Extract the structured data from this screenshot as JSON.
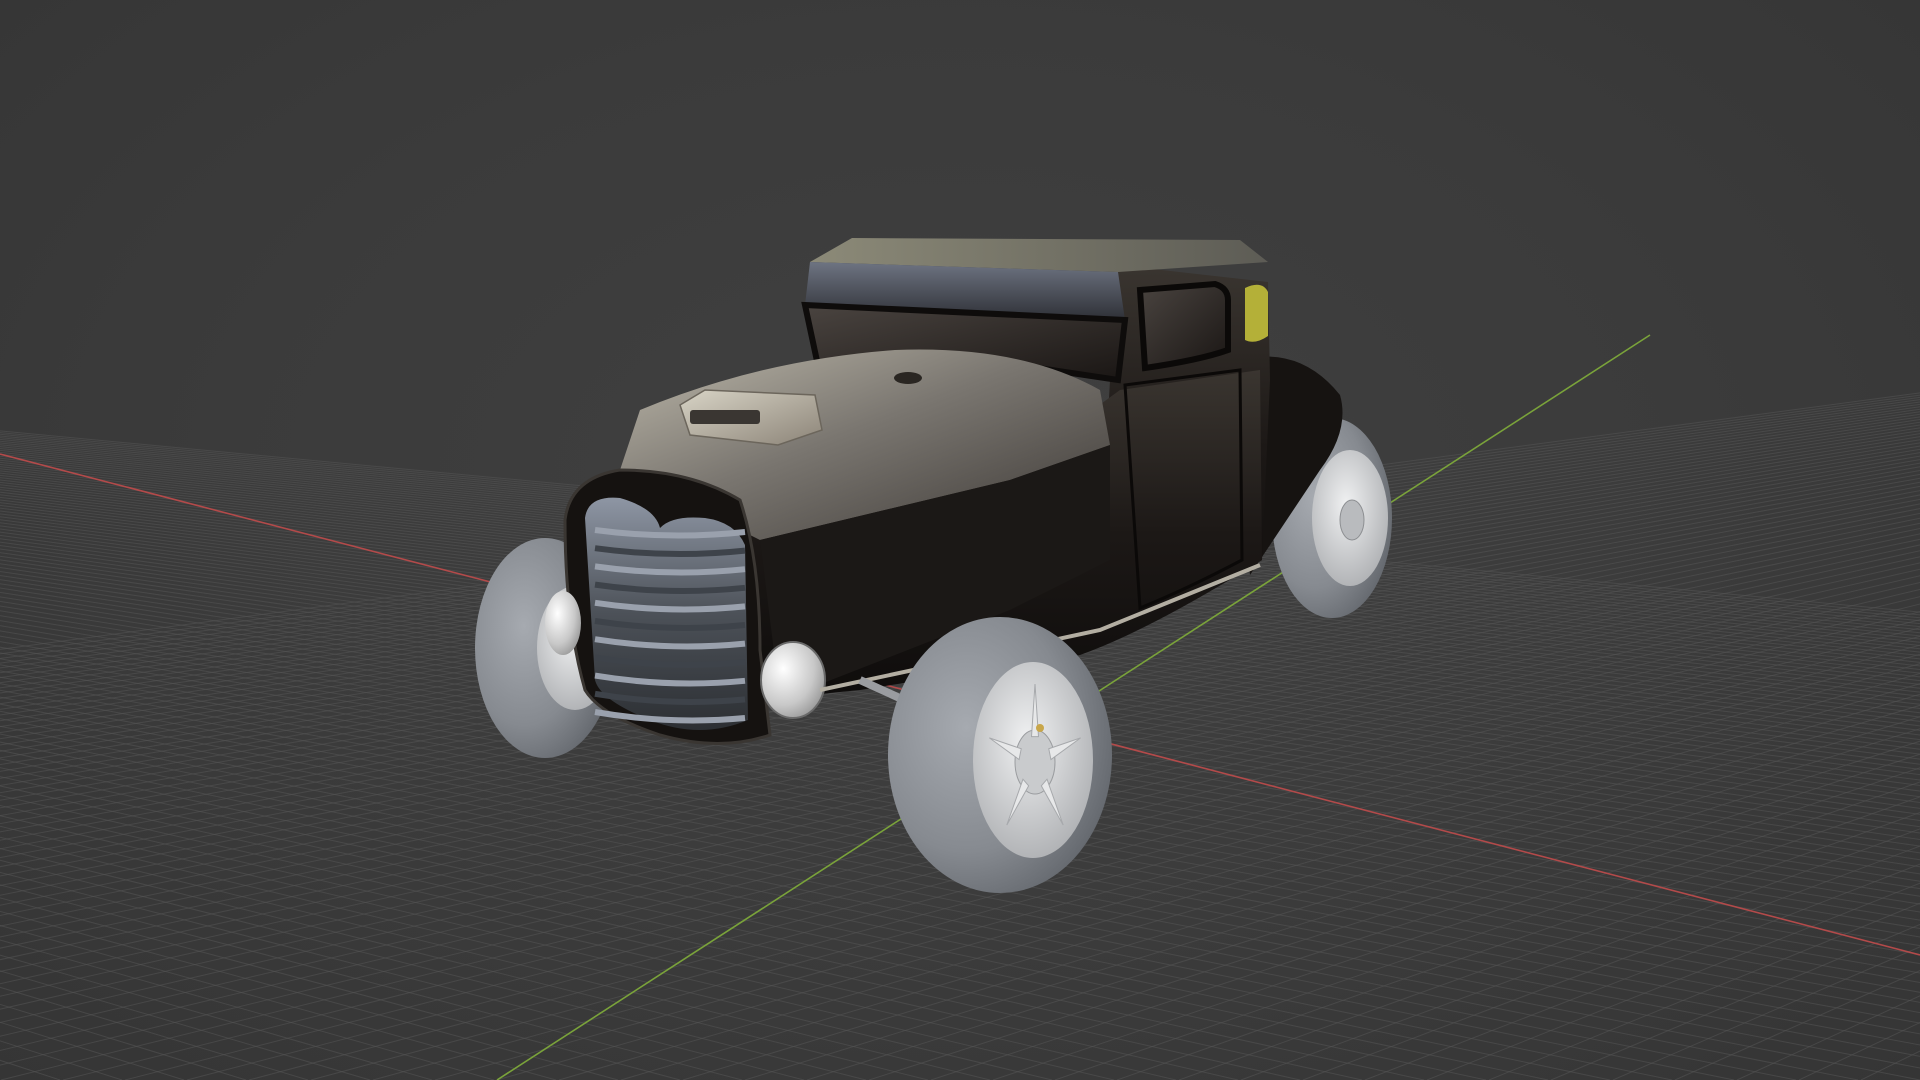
{
  "viewport": {
    "background_color": "#3d3d3d",
    "grid_line_color": "#555555",
    "x_axis_color": "#b34a4a",
    "y_axis_color": "#7aa33a"
  },
  "scene": {
    "object": "hot-rod-coupe",
    "body_color": "#1a1614",
    "roof_color": "#8a8a7c",
    "tire_color": "#8c9096",
    "rim_color": "#cfd1d2",
    "grille_color": "#6b7078",
    "window_tint": "#c6c43a"
  }
}
